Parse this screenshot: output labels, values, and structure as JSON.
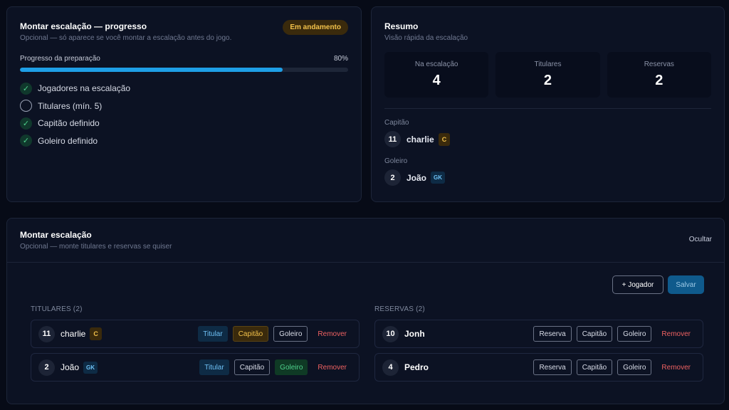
{
  "progress_card": {
    "title": "Montar escalação — progresso",
    "subtitle": "Opcional — só aparece se você montar a escalação antes do jogo.",
    "status_badge": "Em andamento",
    "progress_label": "Progresso da preparação",
    "progress_percent_text": "80%",
    "progress_fraction": 0.8,
    "checklist": [
      {
        "label": "Jogadores na escalação",
        "done": true
      },
      {
        "label": "Titulares (mín. 5)",
        "done": false
      },
      {
        "label": "Capitão definido",
        "done": true
      },
      {
        "label": "Goleiro definido",
        "done": true
      }
    ]
  },
  "summary_card": {
    "title": "Resumo",
    "subtitle": "Visão rápida da escalação",
    "stats": [
      {
        "label": "Na escalação",
        "value": "4"
      },
      {
        "label": "Titulares",
        "value": "2"
      },
      {
        "label": "Reservas",
        "value": "2"
      }
    ],
    "captain_label": "Capitão",
    "captain": {
      "number": "11",
      "name": "charlie",
      "tag": "C"
    },
    "goalkeeper_label": "Goleiro",
    "goalkeeper": {
      "number": "2",
      "name": "João",
      "tag": "GK"
    }
  },
  "lineup_card": {
    "title": "Montar escalação",
    "subtitle": "Opcional — monte titulares e reservas se quiser",
    "hide_link": "Ocultar",
    "add_player_button": "+ Jogador",
    "save_button": "Salvar",
    "starters_title": "TITULARES (2)",
    "reserves_title": "RESERVAS (2)",
    "starters": [
      {
        "number": "11",
        "name": "charlie",
        "tag": "C",
        "role_label": "Titular",
        "captain_label": "Capitão",
        "gk_label": "Goleiro",
        "remove_label": "Remover"
      },
      {
        "number": "2",
        "name": "João",
        "tag": "GK",
        "role_label": "Titular",
        "captain_label": "Capitão",
        "gk_label": "Goleiro",
        "remove_label": "Remover"
      }
    ],
    "reserves": [
      {
        "number": "10",
        "name": "Jonh",
        "role_label": "Reserva",
        "captain_label": "Capitão",
        "gk_label": "Goleiro",
        "remove_label": "Remover"
      },
      {
        "number": "4",
        "name": "Pedro",
        "role_label": "Reserva",
        "captain_label": "Capitão",
        "gk_label": "Goleiro",
        "remove_label": "Remover"
      }
    ]
  },
  "colors": {
    "background": "#070b17",
    "card": "#0c1223",
    "accent_blue": "#1e9fe6",
    "captain_gold": "#f2c14a",
    "success_green": "#4fd28c",
    "danger_red": "#ef6262"
  }
}
